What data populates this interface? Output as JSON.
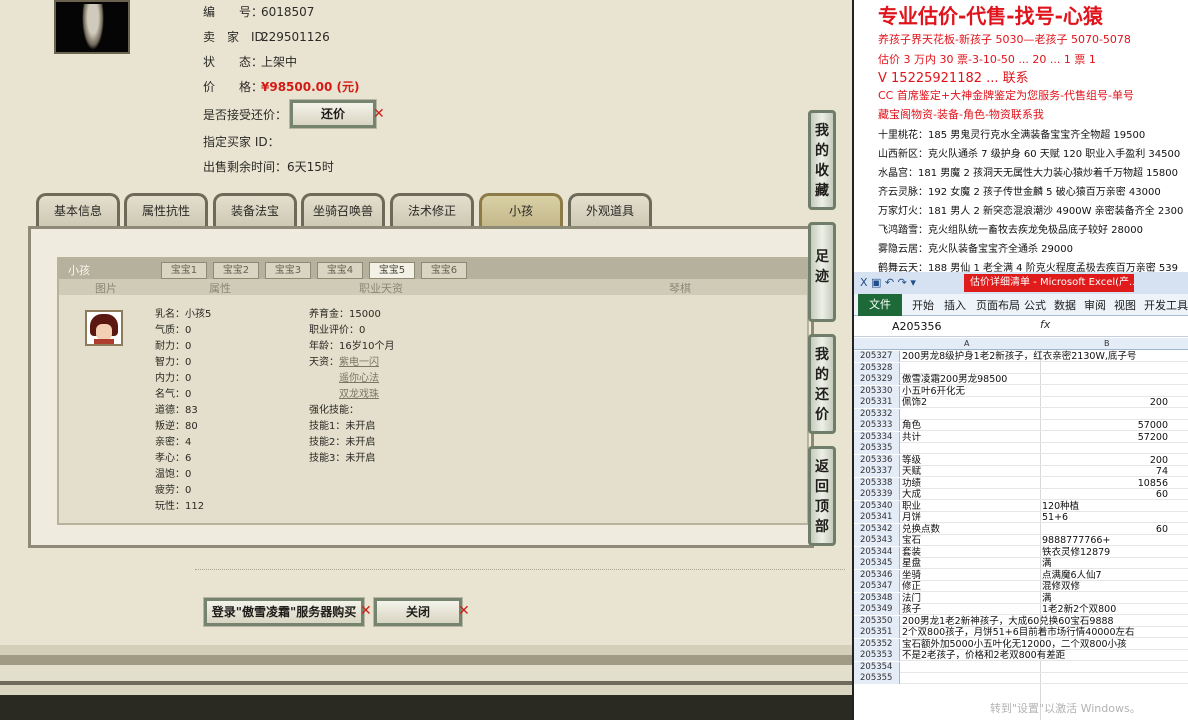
{
  "game": {
    "info": [
      {
        "label": "编　　号：",
        "value": "6018507"
      },
      {
        "label": "卖　家　ID：",
        "value": "229501126"
      },
      {
        "label": "状　　态：",
        "value": "上架中"
      },
      {
        "label": "价　　格：",
        "value": "¥98500.00 (元)"
      }
    ],
    "counter_offer_label": "是否接受还价：",
    "counter_offer_button": "还价",
    "buyer_id_label": "指定买家 ID：",
    "remaining_label": "出售剩余时间：",
    "remaining_value": "6天15时",
    "tabs": [
      "基本信息",
      "属性抗性",
      "装备法宝",
      "坐骑召唤兽",
      "法术修正",
      "小孩",
      "外观道具"
    ],
    "active_tab": "小孩",
    "panel_title": "小孩",
    "pet_tabs": [
      "宝宝1",
      "宝宝2",
      "宝宝3",
      "宝宝4",
      "宝宝5",
      "宝宝6"
    ],
    "col_headers": [
      "图片",
      "属性",
      "职业天资",
      "琴棋"
    ],
    "stats_left": [
      "乳名：小孩5",
      "气质：0",
      "耐力：0",
      "智力：0",
      "内力：0",
      "名气：0",
      "道德：83",
      "叛逆：80",
      "亲密：4",
      "孝心：6",
      "温饱：0",
      "疲劳：0",
      "玩性：112"
    ],
    "stats_mid": [
      "养育金：15000",
      "职业评价：0",
      "年龄：16岁10个月",
      "天资："
    ],
    "talents": [
      "紫电一闪",
      "遥你心法",
      "双龙戏珠"
    ],
    "skills_header": "强化技能：",
    "skills": [
      "技能1：未开启",
      "技能2：未开启",
      "技能3：未开启"
    ],
    "side_buttons": [
      [
        "我",
        "的",
        "收",
        "藏"
      ],
      [
        "足",
        "迹"
      ],
      [
        "我",
        "的",
        "还",
        "价"
      ],
      [
        "返",
        "回",
        "顶",
        "部"
      ]
    ],
    "login_button": "登录\"傲雪凌霜\"服务器购买",
    "close_button": "关闭"
  },
  "ad": {
    "headline": "专业估价-代售-找号-心猿",
    "lines": [
      "养孩子界天花板-新孩子 5030—老孩子 5070-5078",
      "估价 3 万内 30 票-3-10-50 ... 20 ... 1 票 1",
      "V 15225921182 ... 联系",
      "CC 首席鉴定+大神金牌鉴定为您服务-代售组号-单号",
      "藏宝阁物资-装备-角色-物资联系我"
    ],
    "list": [
      "十里桃花：185 男鬼灵行克水全满装备宝宝齐全物超 19500",
      "山西新区：克火队通杀 7 级护身 60 天赋 120 职业入手盈利 34500",
      "水晶宫：181 男魔 2 孩洞天无属性大力装心猿炒着千万物超 15800",
      "齐云灵脉：192 女魔 2 孩子传世金麟 5 破心猿百万亲密 43000",
      "万家灯火：181 男人 2 新突恋混浪潮沙 4900W 亲密装备齐全 2300",
      "飞鸿踏雪：克火组队统一畜牧去疾龙免极品底子较好 28000",
      "雾隐云居：克火队装备宝宝齐全通杀 29000",
      "鹤舞云天：188 男仙 1 老全满 4 阶克火程度孟极去疾百万亲密 539"
    ]
  },
  "excel": {
    "title": "估价详细清单 - Microsoft Excel(产...",
    "ribbon_tabs": [
      "文件",
      "开始",
      "插入",
      "页面布局",
      "公式",
      "数据",
      "审阅",
      "视图",
      "开发工具"
    ],
    "name_box": "A205356",
    "fx": "fx",
    "col_letters": [
      "A",
      "B"
    ],
    "rows": [
      {
        "n": "205327",
        "a": "200男龙8级护身1老2新孩子，红衣亲密2130W,底子号",
        "b": ""
      },
      {
        "n": "205328",
        "a": "",
        "b": ""
      },
      {
        "n": "205329",
        "a": "傲雪凌霜200男龙98500",
        "b": ""
      },
      {
        "n": "205330",
        "a": "小五叶6开化无",
        "b": ""
      },
      {
        "n": "205331",
        "a": "佩饰2",
        "b": "200"
      },
      {
        "n": "205332",
        "a": "",
        "b": ""
      },
      {
        "n": "205333",
        "a": "角色",
        "b": "57000"
      },
      {
        "n": "205334",
        "a": "共计",
        "b": "57200"
      },
      {
        "n": "205335",
        "a": "",
        "b": ""
      },
      {
        "n": "205336",
        "a": "等级",
        "b": "200"
      },
      {
        "n": "205337",
        "a": "天赋",
        "b": "74"
      },
      {
        "n": "205338",
        "a": "功绩",
        "b": "10856"
      },
      {
        "n": "205339",
        "a": "大成",
        "b": "60"
      },
      {
        "n": "205340",
        "a": "职业",
        "bt": "120种植"
      },
      {
        "n": "205341",
        "a": "月饼",
        "bt": "51+6"
      },
      {
        "n": "205342",
        "a": "兑换点数",
        "b": "60"
      },
      {
        "n": "205343",
        "a": "宝石",
        "bt": "9888777766+"
      },
      {
        "n": "205344",
        "a": "套装",
        "bt": "铁衣灵修12879"
      },
      {
        "n": "205345",
        "a": "星盘",
        "bt": "满"
      },
      {
        "n": "205346",
        "a": "坐骑",
        "bt": "点满魔6人仙7"
      },
      {
        "n": "205347",
        "a": "修正",
        "bt": "混修双修"
      },
      {
        "n": "205348",
        "a": "法门",
        "bt": "满"
      },
      {
        "n": "205349",
        "a": "孩子",
        "bt": "1老2新2个双800"
      },
      {
        "n": "205350",
        "a": "200男龙1老2新神孩子，大成60兑换60宝石9888",
        "b": ""
      },
      {
        "n": "205351",
        "a": "2个双800孩子，月饼51+6目前着市场行情40000左右",
        "b": ""
      },
      {
        "n": "205352",
        "a": "宝石额外加5000小五叶化无12000，二个双800小孩",
        "b": ""
      },
      {
        "n": "205353",
        "a": "不是2老孩子，价格和2老双800有差距",
        "b": ""
      },
      {
        "n": "205354",
        "a": "",
        "b": ""
      },
      {
        "n": "205355",
        "a": "",
        "b": ""
      }
    ],
    "watermark": "转到\"设置\"以激活 Windows。"
  }
}
